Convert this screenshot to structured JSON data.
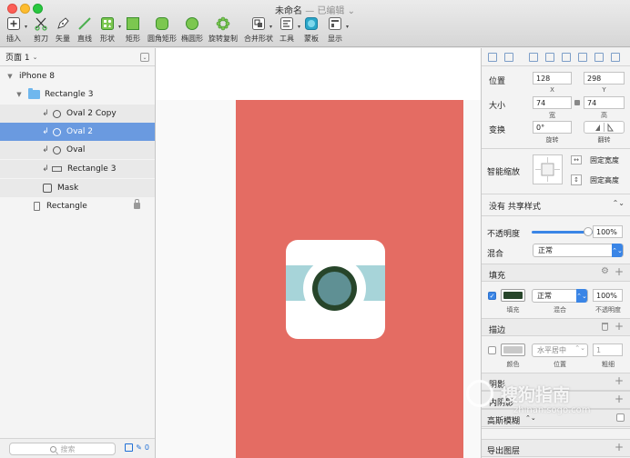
{
  "window": {
    "title": "未命名",
    "edited": "— 已编辑",
    "title_chevron": "⌄"
  },
  "toolbar": [
    {
      "id": "insert",
      "label": "插入",
      "icon": "plus-square-icon",
      "dropdown": true
    },
    {
      "id": "scissors",
      "label": "剪刀",
      "icon": "scissors-icon",
      "dropdown": false
    },
    {
      "id": "vector",
      "label": "矢量",
      "icon": "pen-icon",
      "dropdown": false
    },
    {
      "id": "line",
      "label": "直线",
      "icon": "line-icon",
      "dropdown": false
    },
    {
      "id": "shape",
      "label": "形状",
      "icon": "shapes-icon",
      "dropdown": true
    },
    {
      "id": "rect",
      "label": "矩形",
      "icon": "rectangle-icon",
      "dropdown": false
    },
    {
      "id": "roundrect",
      "label": "圆角矩形",
      "icon": "rounded-rectangle-icon",
      "dropdown": false
    },
    {
      "id": "oval",
      "label": "椭圆形",
      "icon": "oval-icon",
      "dropdown": false
    },
    {
      "id": "rotate-copy",
      "label": "旋转复制",
      "icon": "rotate-copies-icon",
      "dropdown": false
    },
    {
      "id": "combine",
      "label": "合并形状",
      "icon": "combine-shapes-icon",
      "dropdown": true
    },
    {
      "id": "tools",
      "label": "工具",
      "icon": "tools-icon",
      "dropdown": true
    },
    {
      "id": "mask",
      "label": "蒙板",
      "icon": "mask-icon",
      "dropdown": false
    },
    {
      "id": "view",
      "label": "显示",
      "icon": "view-icon",
      "dropdown": true
    }
  ],
  "layers_panel": {
    "page_label": "页面 1",
    "page_chevron": "⌄",
    "layers": [
      {
        "name": "iPhone 8",
        "type": "artboard-group",
        "indent": 0
      },
      {
        "name": "Rectangle 3",
        "type": "group",
        "indent": 1
      },
      {
        "name": "Oval 2 Copy",
        "type": "oval",
        "indent": 2,
        "masked": true
      },
      {
        "name": "Oval 2",
        "type": "oval",
        "indent": 2,
        "masked": true,
        "selected": true
      },
      {
        "name": "Oval",
        "type": "oval",
        "indent": 2,
        "masked": true
      },
      {
        "name": "Rectangle 3",
        "type": "rect",
        "indent": 2,
        "masked": true
      },
      {
        "name": "Mask",
        "type": "mask",
        "indent": 2
      },
      {
        "name": "Rectangle",
        "type": "artboard-rect",
        "indent": 1,
        "locked": true
      }
    ],
    "filter_placeholder": "搜索",
    "slice_count": "0"
  },
  "canvas": {
    "artboard_color": "#e46c63",
    "icon_bg": "#ffffff",
    "band_color": "#a7d4d9",
    "ring_color": "#27452a",
    "inner_color": "#5f9094"
  },
  "inspector": {
    "position": {
      "label": "位置",
      "x": "128",
      "y": "298",
      "x_label": "X",
      "y_label": "Y"
    },
    "size": {
      "label": "大小",
      "w": "74",
      "h": "74",
      "w_label": "宽",
      "h_label": "高"
    },
    "transform": {
      "label": "变换",
      "rotate": "0°",
      "rotate_label": "旋转",
      "flip_label": "翻转"
    },
    "resizing": {
      "label": "智能缩放",
      "fix_width": "固定宽度",
      "fix_height": "固定高度"
    },
    "shared_style": "没有 共享样式",
    "opacity": {
      "label": "不透明度",
      "value": "100%",
      "level": 1.0
    },
    "blending": {
      "label": "混合",
      "value": "正常"
    },
    "fills": {
      "label": "填充",
      "item": {
        "color": "#27452a",
        "blend": "正常",
        "opacity": "100%",
        "sub_fill": "填充",
        "sub_blend": "混合",
        "sub_opacity": "不透明度"
      }
    },
    "borders": {
      "label": "描边",
      "item": {
        "color": "#c8c8c8",
        "position": "水平居中",
        "thickness": "1",
        "sub_color": "颜色",
        "sub_position": "位置",
        "sub_thickness": "粗细"
      }
    },
    "shadows": "阴影",
    "inner_shadows": "内阴影",
    "blur": {
      "label": "高斯模糊",
      "chevron": "⌃⌄"
    },
    "export": "导出图层"
  },
  "watermark": {
    "brand": "搜狗指南",
    "url": "zhinan.sogo.com"
  }
}
